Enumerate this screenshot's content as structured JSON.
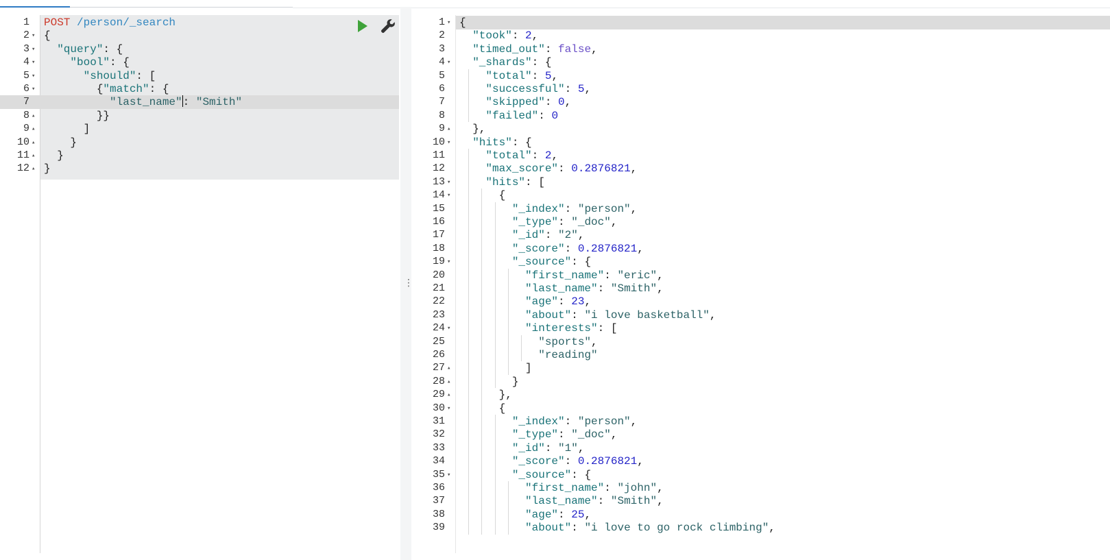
{
  "request": {
    "method": "POST",
    "path": "/person/_search",
    "lines": [
      {
        "num": "1",
        "fold": ""
      },
      {
        "num": "2",
        "fold": "down",
        "text": "{"
      },
      {
        "num": "3",
        "fold": "down",
        "text": "  \"query\": {"
      },
      {
        "num": "4",
        "fold": "down",
        "text": "    \"bool\": {"
      },
      {
        "num": "5",
        "fold": "down",
        "text": "      \"should\": ["
      },
      {
        "num": "6",
        "fold": "down",
        "text": "        {\"match\": {"
      },
      {
        "num": "7",
        "fold": "",
        "text": "          \"last_name\": \"Smith\""
      },
      {
        "num": "8",
        "fold": "up",
        "text": "        }}"
      },
      {
        "num": "9",
        "fold": "up",
        "text": "      ]"
      },
      {
        "num": "10",
        "fold": "up",
        "text": "    }"
      },
      {
        "num": "11",
        "fold": "up",
        "text": "  }"
      },
      {
        "num": "12",
        "fold": "up",
        "text": "}"
      }
    ],
    "actions": {
      "run_icon": "play-icon",
      "settings_icon": "wrench-icon"
    }
  },
  "response": {
    "lines": [
      {
        "num": "1",
        "fold": "down",
        "text": "{"
      },
      {
        "num": "2",
        "fold": "",
        "text": "  \"took\": 2,"
      },
      {
        "num": "3",
        "fold": "",
        "text": "  \"timed_out\": false,"
      },
      {
        "num": "4",
        "fold": "down",
        "text": "  \"_shards\": {"
      },
      {
        "num": "5",
        "fold": "",
        "text": "    \"total\": 5,"
      },
      {
        "num": "6",
        "fold": "",
        "text": "    \"successful\": 5,"
      },
      {
        "num": "7",
        "fold": "",
        "text": "    \"skipped\": 0,"
      },
      {
        "num": "8",
        "fold": "",
        "text": "    \"failed\": 0"
      },
      {
        "num": "9",
        "fold": "up",
        "text": "  },"
      },
      {
        "num": "10",
        "fold": "down",
        "text": "  \"hits\": {"
      },
      {
        "num": "11",
        "fold": "",
        "text": "    \"total\": 2,"
      },
      {
        "num": "12",
        "fold": "",
        "text": "    \"max_score\": 0.2876821,"
      },
      {
        "num": "13",
        "fold": "down",
        "text": "    \"hits\": ["
      },
      {
        "num": "14",
        "fold": "down",
        "text": "      {"
      },
      {
        "num": "15",
        "fold": "",
        "text": "        \"_index\": \"person\","
      },
      {
        "num": "16",
        "fold": "",
        "text": "        \"_type\": \"_doc\","
      },
      {
        "num": "17",
        "fold": "",
        "text": "        \"_id\": \"2\","
      },
      {
        "num": "18",
        "fold": "",
        "text": "        \"_score\": 0.2876821,"
      },
      {
        "num": "19",
        "fold": "down",
        "text": "        \"_source\": {"
      },
      {
        "num": "20",
        "fold": "",
        "text": "          \"first_name\": \"eric\","
      },
      {
        "num": "21",
        "fold": "",
        "text": "          \"last_name\": \"Smith\","
      },
      {
        "num": "22",
        "fold": "",
        "text": "          \"age\": 23,"
      },
      {
        "num": "23",
        "fold": "",
        "text": "          \"about\": \"i love basketball\","
      },
      {
        "num": "24",
        "fold": "down",
        "text": "          \"interests\": ["
      },
      {
        "num": "25",
        "fold": "",
        "text": "            \"sports\","
      },
      {
        "num": "26",
        "fold": "",
        "text": "            \"reading\""
      },
      {
        "num": "27",
        "fold": "up",
        "text": "          ]"
      },
      {
        "num": "28",
        "fold": "up",
        "text": "        }"
      },
      {
        "num": "29",
        "fold": "up",
        "text": "      },"
      },
      {
        "num": "30",
        "fold": "down",
        "text": "      {"
      },
      {
        "num": "31",
        "fold": "",
        "text": "        \"_index\": \"person\","
      },
      {
        "num": "32",
        "fold": "",
        "text": "        \"_type\": \"_doc\","
      },
      {
        "num": "33",
        "fold": "",
        "text": "        \"_id\": \"1\","
      },
      {
        "num": "34",
        "fold": "",
        "text": "        \"_score\": 0.2876821,"
      },
      {
        "num": "35",
        "fold": "down",
        "text": "        \"_source\": {"
      },
      {
        "num": "36",
        "fold": "",
        "text": "          \"first_name\": \"john\","
      },
      {
        "num": "37",
        "fold": "",
        "text": "          \"last_name\": \"Smith\","
      },
      {
        "num": "38",
        "fold": "",
        "text": "          \"age\": 25,"
      },
      {
        "num": "39",
        "fold": "",
        "text": "          \"about\": \"i love to go rock climbing\","
      }
    ]
  },
  "splitter": {
    "icon": "vertical-ellipsis-icon",
    "glyph": "⋮"
  },
  "colors": {
    "key": "#1a7378",
    "string": "#2c6266",
    "number": "#2424c8",
    "boolean": "#6a4fc7",
    "method": "#cc3a2b",
    "url": "#3387c0",
    "run": "#3fa33a",
    "tab_accent": "#2f7bc4"
  }
}
